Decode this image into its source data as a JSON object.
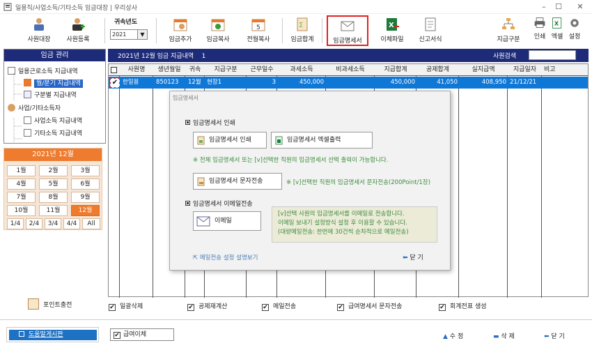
{
  "window": {
    "title": "일용직/사업소득/기타소득 임금대장 | 우리상사"
  },
  "toolbar": {
    "b1": "사원대장",
    "b2": "사원등록",
    "year_label": "귀속년도",
    "year_value": "2021",
    "b3": "임금추가",
    "b4": "임금복사",
    "b5": "전월복사",
    "b6": "임금합계",
    "b7": "임금명세서",
    "b8": "이체파일",
    "b9": "신고서식",
    "b10": "지급구분",
    "b11": "인쇄",
    "b12": "엑셀",
    "b13": "설정"
  },
  "left": {
    "header": "임금 관리",
    "items": [
      "일용근로소득 지급내역",
      "월/분기 지급내역",
      "구분별 지급내역",
      "사업/기타소득자",
      "사업소득 지급내역",
      "기타소득 지급내역"
    ]
  },
  "months": {
    "header": "2021년 12월",
    "buttons": [
      "1월",
      "2월",
      "3월",
      "4월",
      "5월",
      "6월",
      "7월",
      "8월",
      "9월",
      "10월",
      "11월",
      "12월"
    ],
    "quarters": [
      "1/4",
      "2/4",
      "3/4",
      "4/4",
      "All"
    ]
  },
  "grid": {
    "title": "2021년 12월 임금 지급내역",
    "count": "1",
    "search_label": "사원검색",
    "headers": [
      "사원명",
      "생년월일",
      "귀속",
      "지급구분",
      "근무일수",
      "과세소득",
      "비과세소득",
      "지급합계",
      "공제합계",
      "실지급액",
      "지급일자",
      "비고"
    ],
    "row": [
      "한일용",
      "850123",
      "12월",
      "현장1",
      "3",
      "450,000",
      "",
      "450,000",
      "41,050",
      "408,950",
      "21/12/21",
      ""
    ]
  },
  "modal": {
    "title": "임금명세서",
    "sec1": "임금명세서 인쇄",
    "print_btn": "임금명세서 인쇄",
    "excel_btn": "임금명세서 엑셀출력",
    "note1": "※ 전체 임금명세서 또는 [v]선택한 직원의 임금명세서 선택 출력이 가능합니다.",
    "sms_btn": "임금명세서 문자전송",
    "note2": "※ [v]선택한 직원의 임금명세서 문자전송(200Point/1장)",
    "sec2": "임금명세서 이메일전송",
    "email_btn": "이메일",
    "email_note": [
      "[v]선택 사원의 임금명세서를 이메일로 전송합니다.",
      "이메일 보내기 설정방식 설정 후 이용할 수 있습니다.",
      "(대량메일전송: 한번에 30건씩 순차적으로 메일전송)"
    ],
    "setup_link": "메일전송 설정 설명보기",
    "close_btn": "닫 기"
  },
  "bottom": {
    "point": "포인트충전",
    "checks": [
      "일괄삭제",
      "공제재계산",
      "메일전송",
      "급여명세서 문자전송",
      "회계전표 생성"
    ]
  },
  "footer": {
    "help": "도움말게시판",
    "payout": "급여이체",
    "edit": "수 정",
    "delete": "삭 제",
    "close": "닫 기"
  }
}
